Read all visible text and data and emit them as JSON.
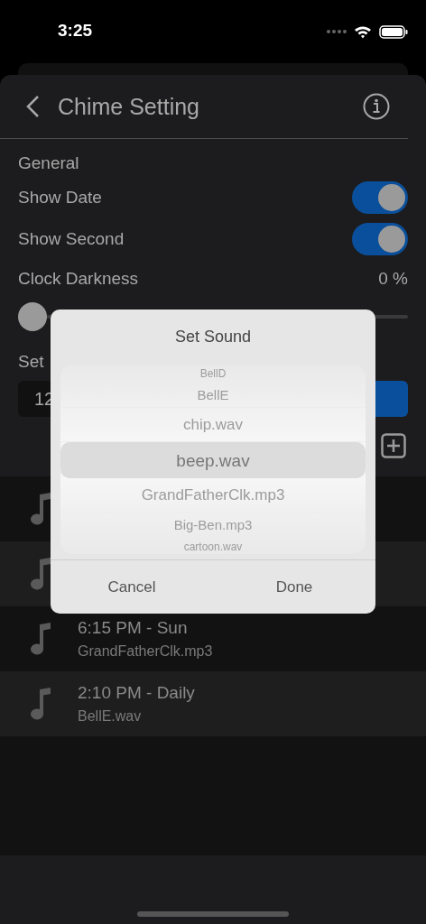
{
  "status_bar": {
    "time": "3:25"
  },
  "header": {
    "title": "Chime Setting"
  },
  "general": {
    "heading": "General",
    "toggles": [
      {
        "label": "Show Date",
        "on": true
      },
      {
        "label": "Show Second",
        "on": true
      }
    ],
    "darkness": {
      "label": "Clock Darkness",
      "reading": "0 %",
      "level": 0
    }
  },
  "set_section": {
    "label": "Set",
    "field_value": "12"
  },
  "chimes": [
    {
      "kind": "covered"
    },
    {
      "kind": "covered"
    },
    {
      "kind": "entry",
      "time": "6:15 PM - Sun",
      "sound": "GrandFatherClk.mp3"
    },
    {
      "kind": "entry",
      "time": "2:10 PM - Daily",
      "sound": "BellE.wav"
    }
  ],
  "dialog": {
    "title": "Set Sound",
    "options": [
      {
        "label": "BellD",
        "selected": false
      },
      {
        "label": "BellE",
        "selected": false
      },
      {
        "label": "chip.wav",
        "selected": false
      },
      {
        "label": "beep.wav",
        "selected": true
      },
      {
        "label": "GrandFatherClk.mp3",
        "selected": false
      },
      {
        "label": "Big-Ben.mp3",
        "selected": false
      },
      {
        "label": "cartoon.wav",
        "selected": false
      }
    ],
    "buttons": [
      "Cancel",
      "Done"
    ]
  }
}
